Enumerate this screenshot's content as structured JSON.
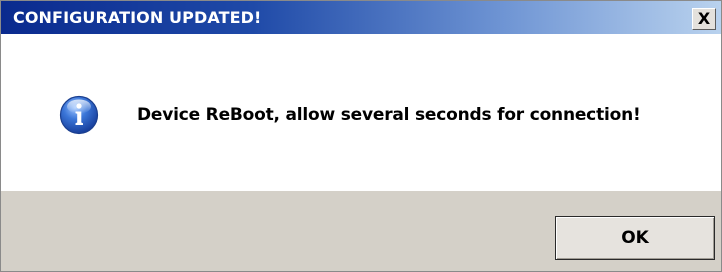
{
  "dialog": {
    "title": "CONFIGURATION UPDATED!",
    "close_label": "X",
    "message": "Device ReBoot, allow several seconds for connection!",
    "icon": "info-icon",
    "ok_label": "OK"
  },
  "colors": {
    "title_gradient_start": "#0a2a8e",
    "title_gradient_end": "#b9d2ee",
    "footer_bg": "#d4d0c8",
    "icon_blue": "#2f6ad0"
  }
}
